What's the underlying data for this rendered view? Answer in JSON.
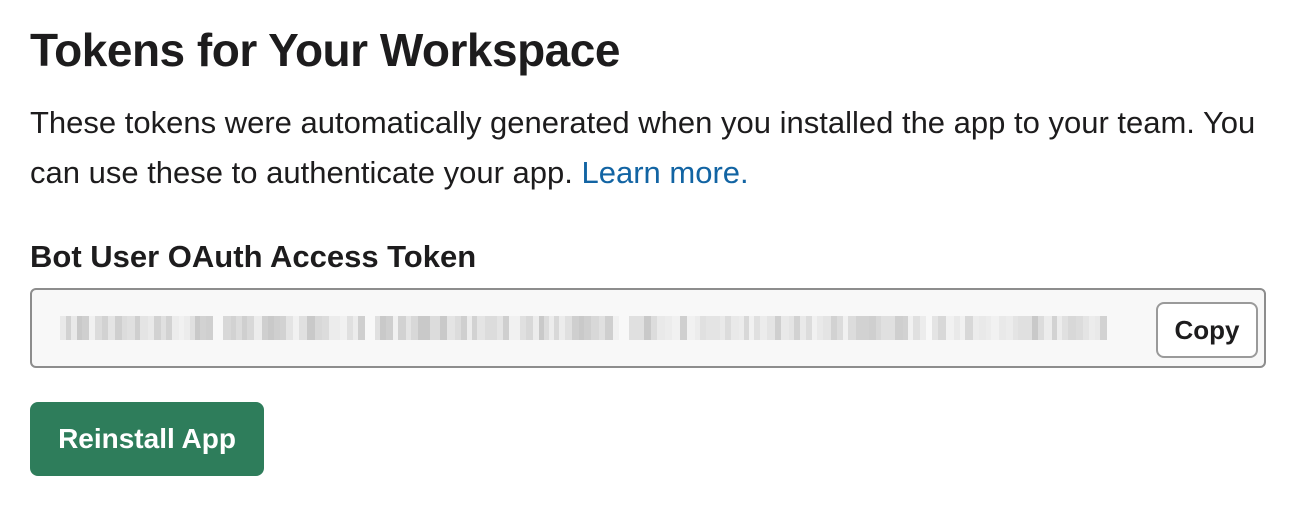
{
  "header": {
    "title": "Tokens for Your Workspace"
  },
  "description": {
    "text": "These tokens were automatically generated when you installed the app to your team. You can use these to authenticate your app.",
    "link_label": "Learn more.",
    "link_color": "#1264a3"
  },
  "token": {
    "label": "Bot User OAuth Access Token",
    "value_state": "obscured",
    "copy_label": "Copy"
  },
  "actions": {
    "reinstall_label": "Reinstall App",
    "reinstall_color": "#2e7d5b"
  }
}
